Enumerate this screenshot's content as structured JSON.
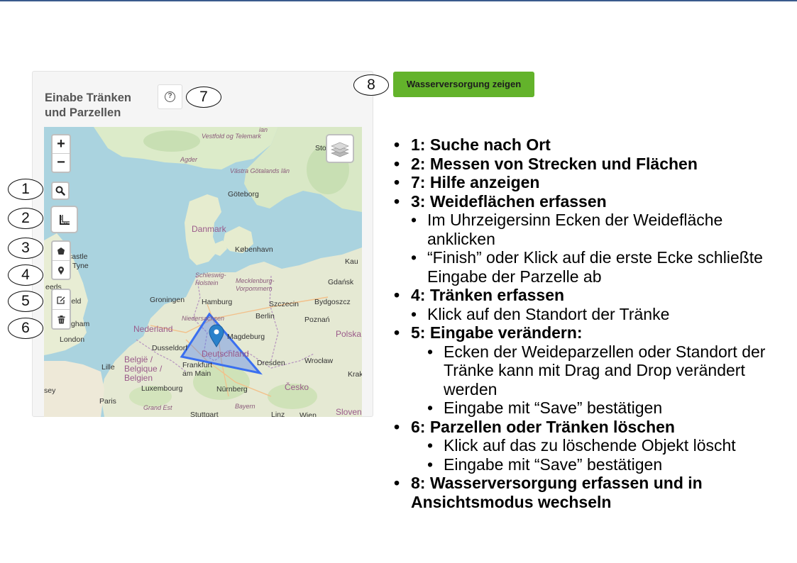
{
  "panel": {
    "title": "Einabe Tränken und Parzellen",
    "help_icon": "question-circle-icon"
  },
  "map": {
    "zoom_in": "+",
    "zoom_out": "−",
    "tools": [
      {
        "icon": "search-icon"
      },
      {
        "icon": "measure-ruler-icon"
      },
      {
        "icon": "draw-polygon-icon"
      },
      {
        "icon": "draw-marker-icon"
      },
      {
        "icon": "edit-icon"
      },
      {
        "icon": "trash-icon"
      }
    ],
    "layers_icon": "layers-icon",
    "labels": {
      "vestfold": "Vestfold og Telemark",
      "agder": "Agder",
      "vastra": "Västra Götalands län",
      "goteborg": "Göteborg",
      "danmark": "Danmark",
      "kobenhavn": "København",
      "castle": "castle",
      "tyne": "Tyne",
      "eeds": "eeds",
      "ield": "ield",
      "gham": "gham",
      "london": "London",
      "schleswig": "Schleswig-Holstein",
      "mecklenburg": "Mecklenburg-Vorpommern",
      "gdansk": "Gdańsk",
      "groningen": "Groningen",
      "hamburg": "Hamburg",
      "szczecin": "Szczecin",
      "bydgoszcz": "Bydgoszcz",
      "niedersachsen": "Niedersachsen",
      "berlin": "Berlin",
      "poznan": "Poznań",
      "nederland": "Nederland",
      "magdeburg": "Magdeburg",
      "polska": "Polska",
      "dusseldorf": "Dusseldorf",
      "deutschland": "Deutschland",
      "dresden": "Dresden",
      "wroclaw": "Wrocław",
      "belgie": "België / Belgique / Belgien",
      "lille": "Lille",
      "frankfurt": "Frankfurt am Main",
      "krak": "Krak",
      "luxembourg": "Luxembourg",
      "cesko": "Česko",
      "sey": "sey",
      "paris": "Paris",
      "nurnberg": "Nürnberg",
      "grandest": "Grand Est",
      "bayern": "Bayern",
      "stuttgart": "Stuttgart",
      "linz": "Linz",
      "wien": "Wien",
      "sloven": "Sloven",
      "sto": "Sto",
      "ian": "ian",
      "kaun": "Kau"
    }
  },
  "callouts": [
    "1",
    "2",
    "3",
    "4",
    "5",
    "6",
    "7",
    "8"
  ],
  "action_button": "Wasserversorgung zeigen",
  "notes": {
    "n1": "1: Suche nach Ort",
    "n2": "2: Messen von Strecken und Flächen",
    "n7": "7: Hilfe anzeigen",
    "n3": "3: Weideflächen erfassen",
    "n3a": "Im Uhrzeigersinn Ecken der Weidefläche anklicken",
    "n3b": "“Finish” oder Klick auf die erste Ecke schließte Eingabe der Parzelle ab",
    "n4": "4: Tränken erfassen",
    "n4a": "Klick auf den Standort der Tränke",
    "n5": "5: Eingabe verändern:",
    "n5a": "Ecken der Weideparzellen oder Standort der Tränke kann mit Drag and Drop verändert werden",
    "n5b": "Eingabe mit “Save” bestätigen",
    "n6": "6: Parzellen oder Tränken löschen",
    "n6a": "Klick auf das zu löschende Objekt löscht",
    "n6b": "Eingabe mit “Save” bestätigen",
    "n8": "8: Wasserversorgung erfassen und in Ansichtsmodus wechseln"
  },
  "colors": {
    "button_green": "#63b32b",
    "polygon_fill": "#3a6ff0",
    "marker": "#2a81cb"
  }
}
